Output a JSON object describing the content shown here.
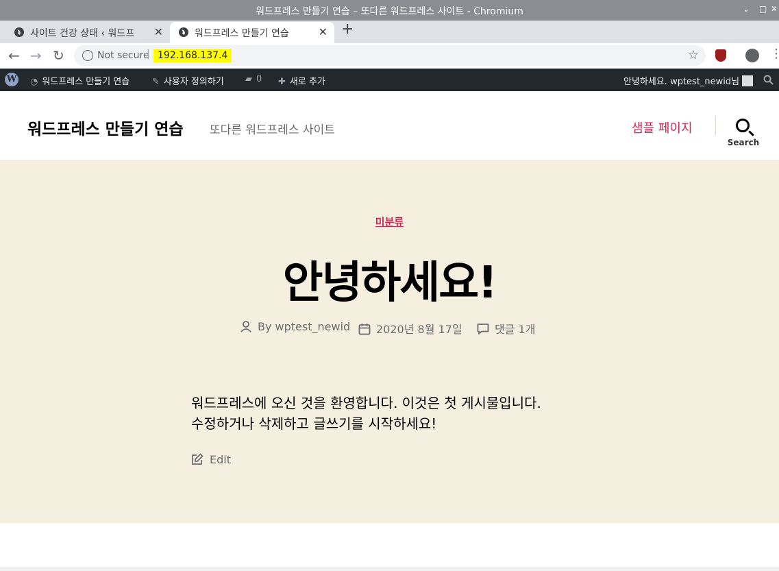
{
  "window": {
    "title": "워드프레스 만들기 연습 – 또다른 워드프레스 사이트 - Chromium",
    "controls": [
      "⌄",
      "□",
      "✕"
    ]
  },
  "tabs": [
    {
      "label": "사이트 건강 상태 ‹ 워드프",
      "active": false,
      "close": "✕"
    },
    {
      "label": "워드프레스 만들기 연습",
      "active": true,
      "close": "✕"
    }
  ],
  "toolbar": {
    "new_tab": "+",
    "back": "←",
    "forward": "→",
    "reload": "↻",
    "security": "Not secure",
    "separator": "|",
    "url": "192.168.137.4",
    "bookmark": "☆",
    "menu": "⋮"
  },
  "adminbar": {
    "site_name": "워드프레스 만들기 연습",
    "customize": "사용자 정의하기",
    "comments_count": "0",
    "new_item": "새로 추가",
    "greeting": "안녕하세요. wptest_newid님"
  },
  "site": {
    "title": "워드프레스 만들기 연습",
    "description": "또다른 워드프레스 사이트",
    "menu_item": "샘플 페이지",
    "search_label": "Search"
  },
  "post": {
    "category": "미분류",
    "title": "안녕하세요!",
    "author": "By wptest_newid",
    "date": "2020년 8월 17일",
    "comments": "댓글 1개",
    "content_line1": "워드프레스에 오신 것을 환영합니다. 이것은 첫 게시물입니다.",
    "content_line2": "수정하거나 삭제하고 글쓰기를 시작하세요!",
    "edit": "Edit"
  },
  "colors": {
    "accent": "#cd2653",
    "entry_bg": "#f5efe0",
    "adminbar_bg": "#23282d",
    "url_highlight": "#ffff00"
  }
}
